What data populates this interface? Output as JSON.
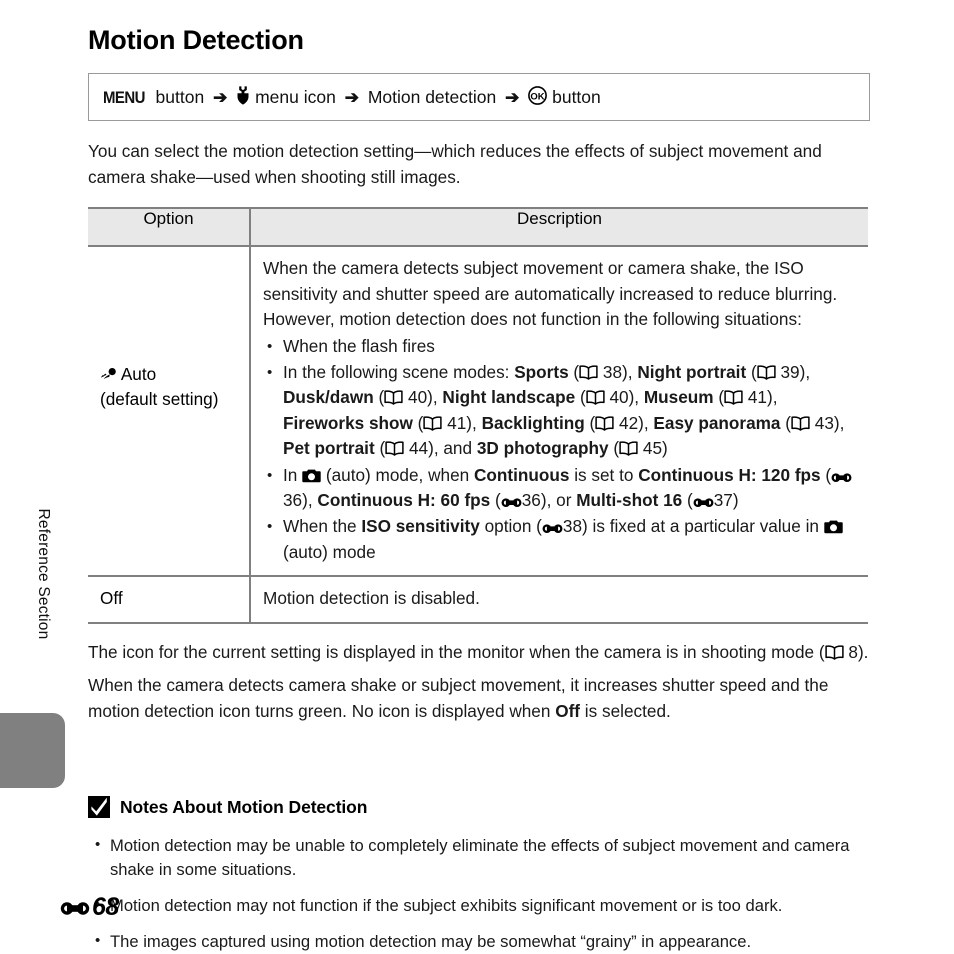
{
  "sidebar": {
    "vertical_label": "Reference Section",
    "tab_color": "#808080"
  },
  "page": {
    "title": "Motion Detection",
    "footer_page": "68",
    "footer_icon": "e-marker-icon"
  },
  "nav_path": {
    "menu_button": "MENU",
    "button_word_1": "button",
    "arrow": "➔",
    "setup_icon": "wrench-icon",
    "menu_icon_label": "menu icon",
    "item_label": "Motion detection",
    "ok_icon": "ok-button-icon",
    "button_word_2": "button"
  },
  "intro": "You can select the motion detection setting—which reduces the effects of subject movement and camera shake—used when shooting still images.",
  "table": {
    "headers": {
      "option": "Option",
      "description": "Description"
    },
    "rows": [
      {
        "option_icon": "motion-detection-icon",
        "option": "Auto",
        "option_sub": "(default setting)",
        "desc_intro": "When the camera detects subject movement or camera shake, the ISO sensitivity and shutter speed are automatically increased to reduce blurring. However, motion detection does not function in the following situations:",
        "bullets": [
          {
            "id": "flash",
            "text": "When the flash fires"
          },
          {
            "id": "scene-modes",
            "lead": "In the following scene modes: ",
            "items": [
              {
                "name": "Sports",
                "page": "38"
              },
              {
                "name": "Night portrait",
                "page": "39"
              },
              {
                "name": "Dusk/dawn",
                "page": "40"
              },
              {
                "name": "Night landscape",
                "page": "40"
              },
              {
                "name": "Museum",
                "page": "41"
              },
              {
                "name": "Fireworks show",
                "page": "41"
              },
              {
                "name": "Backlighting",
                "page": "42"
              },
              {
                "name": "Easy panorama",
                "page": "43"
              },
              {
                "name": "Pet portrait",
                "page": "44"
              },
              {
                "name": "3D photography",
                "page": "45"
              }
            ],
            "conjunction": "and"
          },
          {
            "id": "continuous",
            "prefix_1": "In ",
            "prefix_2": " (auto) mode, when ",
            "setting_name": "Continuous",
            "prefix_3": " is set to ",
            "options": [
              {
                "name": "Continuous H: 120 fps",
                "ref": "36"
              },
              {
                "name": "Continuous H: 60 fps",
                "ref": "36"
              },
              {
                "name": "Multi-shot 16",
                "ref": "37"
              }
            ],
            "separator": ", ",
            "conjunction": "or "
          },
          {
            "id": "iso",
            "prefix": "When the ",
            "setting_name": "ISO sensitivity",
            "middle": " option (",
            "ref": "38",
            "suffix_1": ") is fixed at a particular value in ",
            "suffix_2": " (auto) mode"
          }
        ]
      },
      {
        "option": "Off",
        "desc": "Motion detection is disabled."
      }
    ]
  },
  "after_table": {
    "para1_a": "The icon for the current setting is displayed in the monitor when the camera is in shooting mode (",
    "para1_page": "8",
    "para1_b": ").",
    "para2_a": "When the camera detects camera shake or subject movement, it increases shutter speed and the motion detection icon turns green. No icon is displayed when ",
    "para2_bold": "Off",
    "para2_b": " is selected."
  },
  "notes": {
    "icon": "warning-check-icon",
    "heading": "Notes About Motion Detection",
    "items": [
      "Motion detection may be unable to completely eliminate the effects of subject movement and camera shake in some situations.",
      "Motion detection may not function if the subject exhibits significant movement or is too dark.",
      "The images captured using motion detection may be somewhat “grainy” in appearance."
    ]
  }
}
